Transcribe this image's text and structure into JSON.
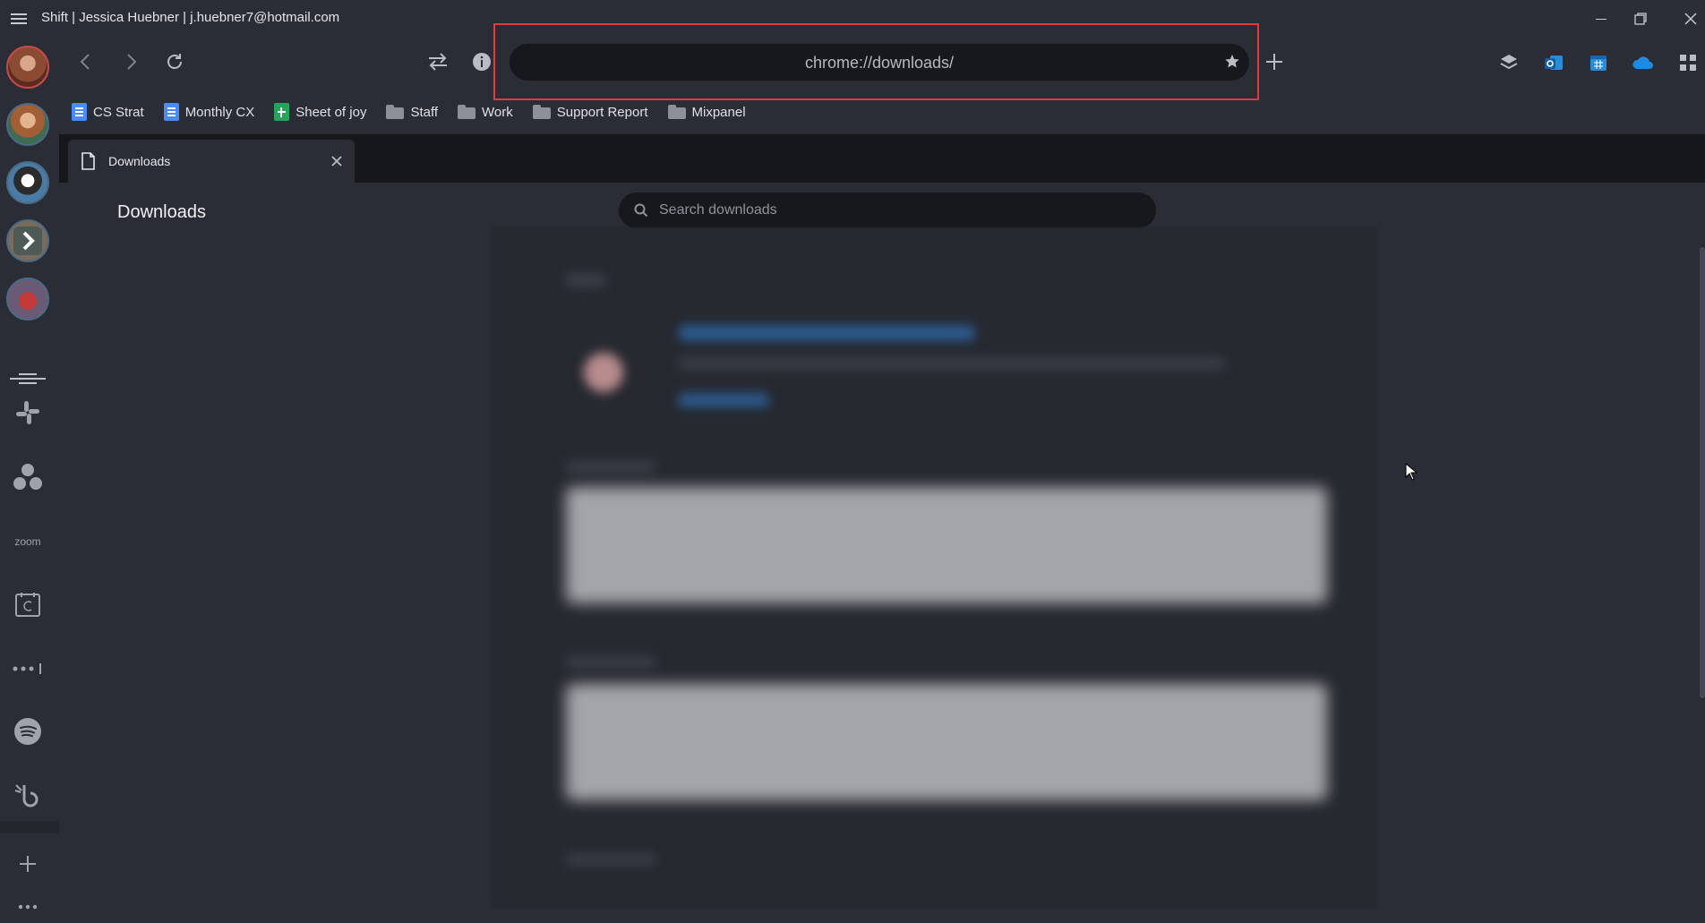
{
  "window": {
    "title": "Shift | Jessica Huebner | j.huebner7@hotmail.com",
    "minimize_icon": "minimize-icon",
    "restore_icon": "restore-icon",
    "close_icon": "close-icon"
  },
  "toolbar": {
    "url": "chrome://downloads/",
    "back_icon": "chevron-left-icon",
    "forward_icon": "chevron-right-icon",
    "reload_icon": "reload-icon",
    "switch_icon": "swap-arrows-icon",
    "info_icon": "info-icon",
    "bookmark_icon": "star-icon",
    "new_tab_icon": "plus-icon",
    "right_icons": [
      "layers-icon",
      "outlook-icon",
      "calendar-icon",
      "onedrive-icon",
      "apps-grid-icon"
    ],
    "highlight_color": "#e0393e"
  },
  "bookmarks": [
    {
      "label": "CS Strat",
      "icon": "google-docs-icon"
    },
    {
      "label": "Monthly CX",
      "icon": "google-docs-icon"
    },
    {
      "label": "Sheet of joy",
      "icon": "google-sheets-icon"
    },
    {
      "label": "Staff",
      "icon": "folder-icon"
    },
    {
      "label": "Work",
      "icon": "folder-icon"
    },
    {
      "label": "Support Report",
      "icon": "folder-icon"
    },
    {
      "label": "Mixpanel",
      "icon": "folder-icon"
    }
  ],
  "sidebar": {
    "accounts": [
      {
        "name": "account-1-avatar",
        "icon": "avatar-icon"
      },
      {
        "name": "account-2-avatar",
        "icon": "avatar-icon"
      },
      {
        "name": "account-3-avatar",
        "icon": "avatar-icon"
      },
      {
        "name": "account-4-avatar",
        "icon": "avatar-icon"
      },
      {
        "name": "account-5-avatar",
        "icon": "avatar-icon"
      }
    ],
    "apps": [
      {
        "name": "slack",
        "icon": "slack-icon"
      },
      {
        "name": "asana",
        "icon": "asana-icon"
      },
      {
        "name": "zoom",
        "label": "zoom"
      },
      {
        "name": "calendar",
        "icon": "calendar-icon"
      },
      {
        "name": "more-apps",
        "icon": "dots-icon"
      },
      {
        "name": "spotify",
        "icon": "spotify-icon"
      },
      {
        "name": "bonusly",
        "icon": "bonusly-icon"
      }
    ],
    "add_icon": "plus-icon",
    "more_icon": "more-dots-icon"
  },
  "tab": {
    "label": "Downloads",
    "icon": "file-icon",
    "close_icon": "close-icon"
  },
  "page": {
    "title": "Downloads",
    "search_placeholder": "Search downloads",
    "search_icon": "search-icon"
  }
}
